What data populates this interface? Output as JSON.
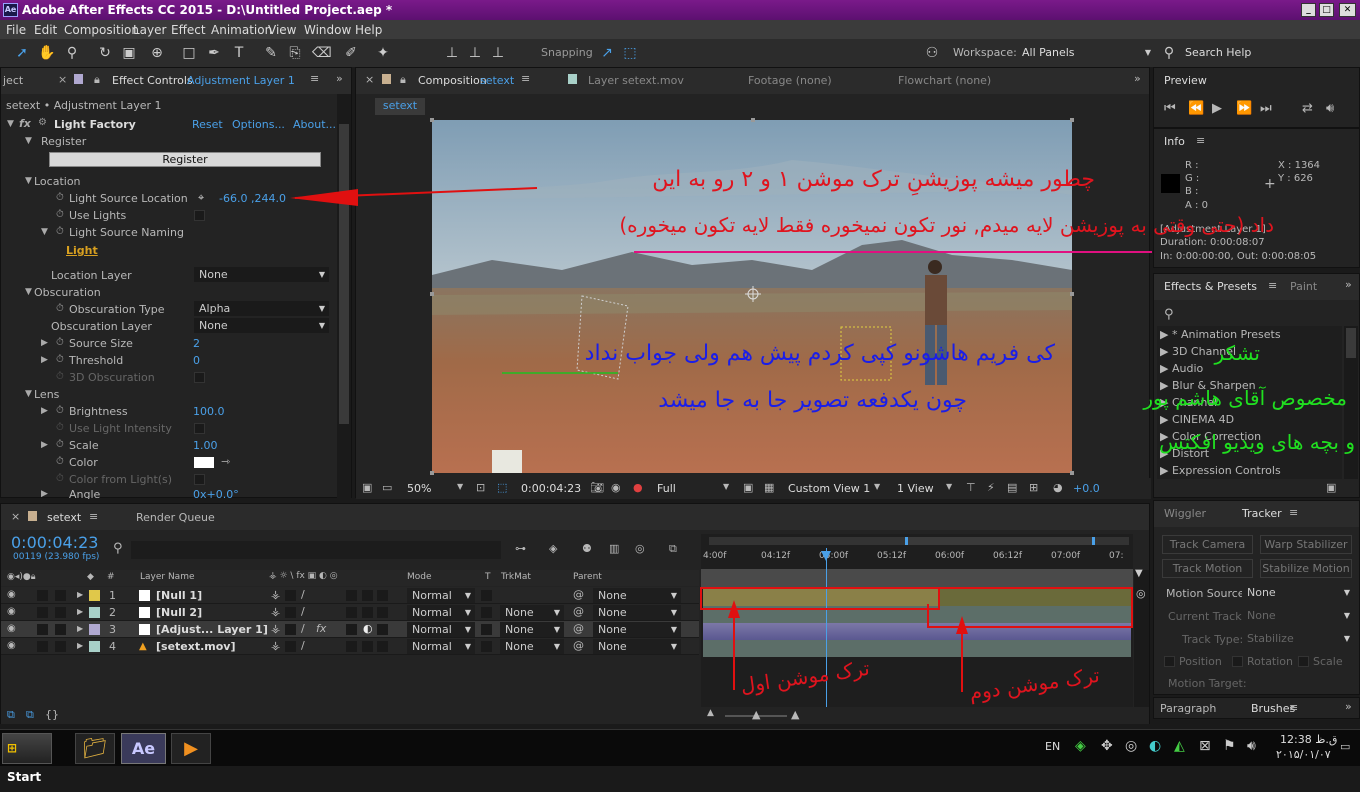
{
  "window": {
    "title": "Adobe After Effects CC 2015 - D:\\Untitled Project.aep *",
    "logo": "Ae"
  },
  "menu": [
    "File",
    "Edit",
    "Composition",
    "Layer",
    "Effect",
    "Animation",
    "View",
    "Window",
    "Help"
  ],
  "toolbar": {
    "snapping": "Snapping",
    "workspace_label": "Workspace:",
    "workspace_value": "All Panels",
    "search_help": "Search Help"
  },
  "left_panel": {
    "tab_project": "ject",
    "tab_effect_controls": "Effect Controls",
    "tab_effect_layer": "Adjustment Layer 1",
    "breadcrumb": "setext • Adjustment Layer 1",
    "effect_name": "Light Factory",
    "reset": "Reset",
    "options": "Options...",
    "about": "About...",
    "register_group": "Register",
    "register_btn": "Register",
    "location_group": "Location",
    "light_source_location": "Light Source Location",
    "lsl_value": "-66.0 ,244.0",
    "use_lights": "Use Lights",
    "light_source_naming": "Light Source Naming",
    "light_word": "Light",
    "location_layer": "Location Layer",
    "location_layer_value": "None",
    "obscuration_group": "Obscuration",
    "obscuration_type": "Obscuration Type",
    "obscuration_type_value": "Alpha",
    "obscuration_layer": "Obscuration Layer",
    "obscuration_layer_value": "None",
    "source_size": "Source Size",
    "source_size_value": "2",
    "threshold": "Threshold",
    "threshold_value": "0",
    "obscuration_3d": "3D Obscuration",
    "lens_group": "Lens",
    "brightness": "Brightness",
    "brightness_value": "100.0",
    "use_light_intensity": "Use Light Intensity",
    "scale": "Scale",
    "scale_value": "1.00",
    "color": "Color",
    "color_from_lights": "Color from Light(s)",
    "angle": "Angle",
    "angle_value": "0x+0.0°"
  },
  "comp_panel": {
    "tab_comp": "Composition",
    "tab_comp_name": "setext",
    "tab_layer": "Layer setext.mov",
    "tab_footage": "Footage (none)",
    "tab_flowchart": "Flowchart (none)",
    "comp_chip": "setext",
    "zoom": "50%",
    "timecode": "0:00:04:23",
    "resolution": "Full",
    "view": "Custom View 1",
    "views": "1 View",
    "exposure": "+0.0"
  },
  "annotations": {
    "red_line1": "چطور میشه پوزیشنِ ترک موشن ۱ و ۲ رو به این",
    "red_line2": "داد (حتی وقتی به پوزیشن لایه میدم, نور تکون نمیخوره فقط لایه تکون میخوره)",
    "blue_line1": "کی فریم هاشونو کپی کردم پیش هم ولی جواب نداد",
    "blue_line2": "چون یکدفعه تصویر جا به جا میشد",
    "green_line1": "تشکر",
    "green_line2": "مخصوص  آقای هاشم پور",
    "green_line3": "و بچه های ویدیو افکتس",
    "track1": "ترک موشن اول",
    "track2": "ترک موشن دوم"
  },
  "right_panel": {
    "preview": "Preview",
    "info": "Info",
    "info_r": "R :",
    "info_g": "G :",
    "info_b": "B :",
    "info_a": "A : 0",
    "info_x": "X : 1364",
    "info_y": "Y : 626",
    "info_layer": "[Adjustment Layer 1]",
    "info_duration": "Duration: 0:00:08:07",
    "info_inout": "In: 0:00:00:00, Out: 0:00:08:05",
    "effects_tab": "Effects & Presets",
    "paint_tab": "Paint",
    "effects": [
      "* Animation Presets",
      "3D Channel",
      "Audio",
      "Blur & Sharpen",
      "Channel",
      "CINEMA 4D",
      "Color Correction",
      "Distort",
      "Expression Controls"
    ],
    "wiggler_tab": "Wiggler",
    "tracker_tab": "Tracker",
    "track_camera": "Track Camera",
    "warp_stabilizer": "Warp Stabilizer",
    "track_motion": "Track Motion",
    "stabilize_motion": "Stabilize Motion",
    "motion_source": "Motion Source:",
    "motion_source_value": "None",
    "current_track": "Current Track:",
    "current_track_value": "None",
    "track_type": "Track Type:",
    "track_type_value": "Stabilize",
    "position": "Position",
    "rotation": "Rotation",
    "scale": "Scale",
    "motion_target": "Motion Target:",
    "paragraph_tab": "Paragraph",
    "brushes_tab": "Brushes"
  },
  "timeline": {
    "tab_comp": "setext",
    "tab_render": "Render Queue",
    "timecode": "0:00:04:23",
    "frames": "00119 (23.980 fps)",
    "col_layer_name": "Layer Name",
    "col_mode": "Mode",
    "col_t": "T",
    "col_trkmat": "TrkMat",
    "col_parent": "Parent",
    "col_hash": "#",
    "ruler": [
      "4:00f",
      "04:12f",
      "05:00f",
      "05:12f",
      "06:00f",
      "06:12f",
      "07:00f",
      "07:"
    ],
    "layers": [
      {
        "num": "1",
        "name": "[Null 1]",
        "mode": "Normal",
        "trkmat": "",
        "parent": "None",
        "color": "#e0c84a"
      },
      {
        "num": "2",
        "name": "[Null 2]",
        "mode": "Normal",
        "trkmat": "None",
        "parent": "None",
        "color": "#a8d0c8"
      },
      {
        "num": "3",
        "name": "[Adjust... Layer 1]",
        "mode": "Normal",
        "trkmat": "None",
        "parent": "None",
        "color": "#b0a8d0"
      },
      {
        "num": "4",
        "name": "[setext.mov]",
        "mode": "Normal",
        "trkmat": "None",
        "parent": "None",
        "color": "#a8d0c8"
      }
    ]
  },
  "taskbar": {
    "start": "Start",
    "lang": "EN",
    "time": "12:38 ق.ظ",
    "date": "۲۰۱۵/۰۱/۰۷",
    "ae": "Ae"
  }
}
